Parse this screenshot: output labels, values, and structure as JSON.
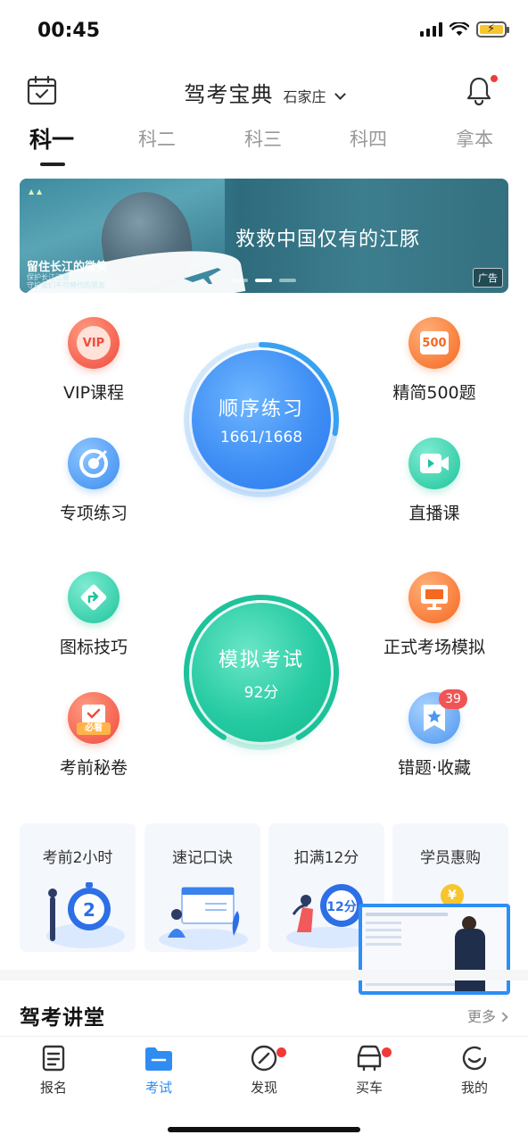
{
  "status_bar": {
    "time": "00:45"
  },
  "header": {
    "app_title": "驾考宝典",
    "city": "石家庄"
  },
  "tabs": [
    {
      "label": "科一",
      "active": true
    },
    {
      "label": "科二",
      "active": false
    },
    {
      "label": "科三",
      "active": false
    },
    {
      "label": "科四",
      "active": false
    },
    {
      "label": "拿本",
      "active": false
    }
  ],
  "banner": {
    "title": "救救中国仅有的江豚",
    "left_title": "留住长江的微笑",
    "left_sub_1": "保护长江江豚",
    "left_sub_2": "守护我们不可替代的朋友",
    "ad_label": "广告",
    "active_dot": 1
  },
  "features": {
    "vip": {
      "label": "VIP课程",
      "icon_text": "VIP"
    },
    "jingjian": {
      "label": "精简500题",
      "icon_text": "500"
    },
    "zhuanxiang": {
      "label": "专项练习"
    },
    "zhibo": {
      "label": "直播课"
    },
    "tubiao": {
      "label": "图标技巧"
    },
    "zhengshi": {
      "label": "正式考场模拟"
    },
    "miju": {
      "label": "考前秘卷",
      "icon_text": "必看"
    },
    "cuoti": {
      "label": "错题·收藏",
      "badge": "39"
    }
  },
  "practice": {
    "title": "顺序练习",
    "progress": "1661/1668",
    "done": 1661,
    "total": 1668
  },
  "exam": {
    "title": "模拟考试",
    "score": "92分"
  },
  "quick_cards": [
    {
      "title": "考前2小时",
      "icon_text": "2"
    },
    {
      "title": "速记口诀"
    },
    {
      "title": "扣满12分",
      "icon_text": "12分"
    },
    {
      "title": "学员惠购",
      "icon_text": "¥"
    }
  ],
  "section": {
    "title": "驾考讲堂",
    "more": "更多"
  },
  "bottom_nav": [
    {
      "label": "报名",
      "active": false,
      "dot": false
    },
    {
      "label": "考试",
      "active": true,
      "dot": false
    },
    {
      "label": "发现",
      "active": false,
      "dot": true
    },
    {
      "label": "买车",
      "active": false,
      "dot": true
    },
    {
      "label": "我的",
      "active": false,
      "dot": false
    }
  ],
  "colors": {
    "accent": "#2f8cf2",
    "teal": "#1ec49b",
    "badge": "#f25454"
  }
}
